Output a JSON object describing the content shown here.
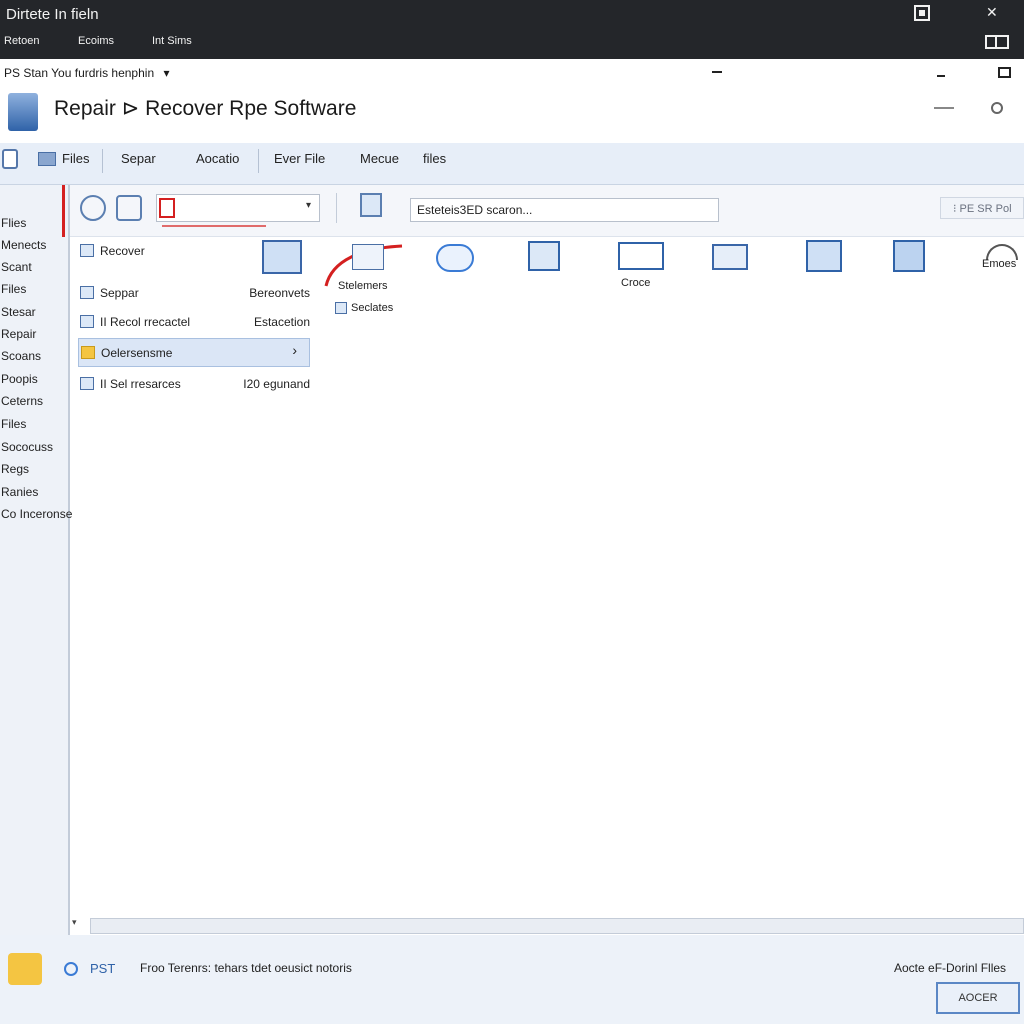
{
  "window": {
    "title": "Dirtete In fieln",
    "menu": [
      "Retoen",
      "Ecoims",
      "Int Sims"
    ]
  },
  "subrow": {
    "crumb": "PS Stan You furdris henphin",
    "dropdown_glyph": "▾"
  },
  "header": {
    "title": "Repair ⊳ Recover Rpe Software"
  },
  "tabs": [
    "Files",
    "Separ",
    "Aocatio",
    "Ever File",
    "Mecue",
    "files"
  ],
  "sidebar": {
    "items": [
      "Flies",
      "Menects",
      "Scant",
      "Files",
      "Stesar",
      "Repair",
      "Scoans",
      "Poopis",
      "Ceterns",
      "Files",
      "Sococuss",
      "Regs",
      "Ranies",
      "Co Inceronse"
    ]
  },
  "toolbar": {
    "search_placeholder": "Esteteis3ED scaron...",
    "right_button": "⁝ PE SR Pol"
  },
  "left_list": [
    {
      "label": "Recover",
      "right": ""
    },
    {
      "label": "Seppar",
      "right": "Bereonvets"
    },
    {
      "label": "II Recol rrecactel",
      "right": "Estacetion"
    },
    {
      "label": "Oelersensme",
      "right": "›"
    },
    {
      "label": "II Sel rresarces",
      "right": "I20 egunand"
    }
  ],
  "icons": [
    {
      "name": "screen-icon",
      "caption": ""
    },
    {
      "name": "folder-icon",
      "caption": "Stelemers"
    },
    {
      "name": "cloud-icon",
      "caption": ""
    },
    {
      "name": "list-icon",
      "caption": ""
    },
    {
      "name": "grid-icon",
      "caption": "Croce"
    },
    {
      "name": "window-icon",
      "caption": ""
    },
    {
      "name": "document-icon",
      "caption": ""
    },
    {
      "name": "chart-icon",
      "caption": ""
    },
    {
      "name": "arc-icon",
      "caption": "Emoes"
    }
  ],
  "icon_sub_caption": "Seclates",
  "footer": {
    "pst": "PST",
    "message": "Froo Terenrs: tehars tdet oeusict notoris",
    "right_text": "Aocte eF-Dorinl Flles",
    "ok_label": "AOCER"
  },
  "colors": {
    "titlebar": "#24262a",
    "tabs": "#e7eef8",
    "accent": "#4a78c2",
    "red_mark": "#d42020"
  }
}
